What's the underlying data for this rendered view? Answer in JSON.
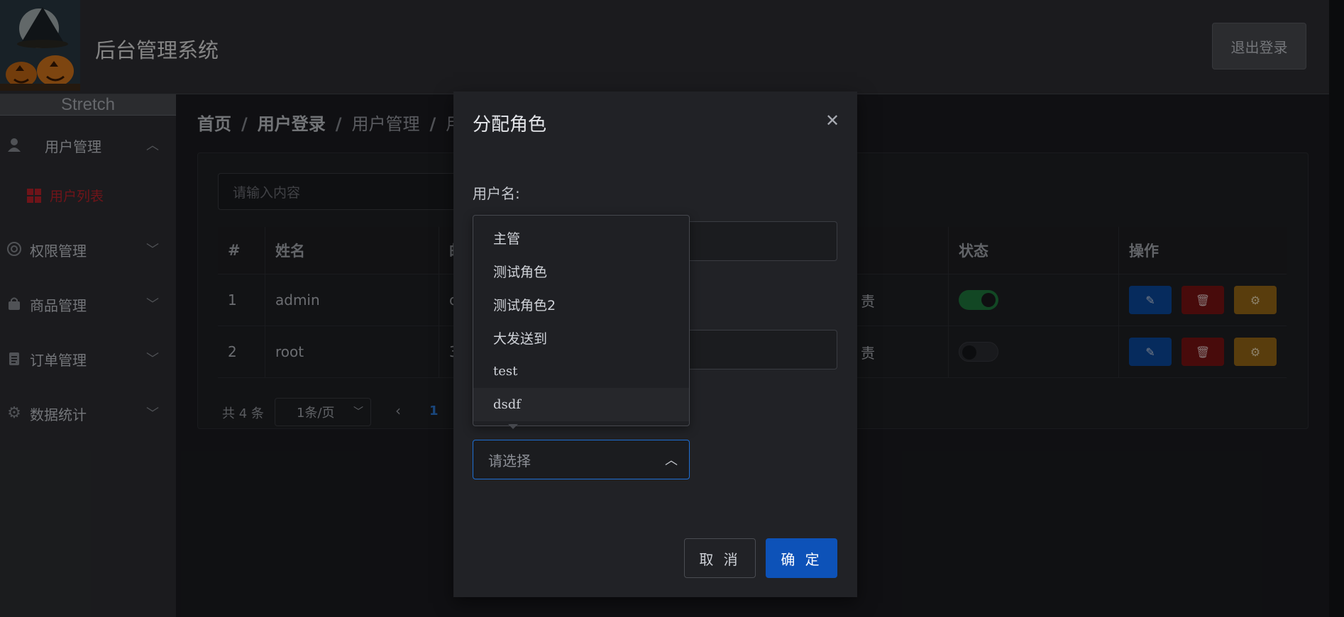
{
  "header": {
    "title": "后台管理系统",
    "logout_label": "退出登录"
  },
  "sidebar": {
    "stretch_label": "Stretch",
    "items": [
      {
        "label": "用户管理",
        "icon": "user-icon",
        "expanded": true,
        "children": [
          {
            "label": "用户列表",
            "icon": "grid-icon",
            "active": true
          }
        ]
      },
      {
        "label": "权限管理",
        "icon": "lifebuoy-icon",
        "expanded": false
      },
      {
        "label": "商品管理",
        "icon": "bag-icon",
        "expanded": false
      },
      {
        "label": "订单管理",
        "icon": "clipboard-icon",
        "expanded": false
      },
      {
        "label": "数据统计",
        "icon": "gear-icon",
        "expanded": false
      }
    ]
  },
  "breadcrumb": {
    "items": [
      "首页",
      "用户登录",
      "用户管理",
      "用"
    ]
  },
  "search": {
    "placeholder": "请输入内容"
  },
  "table": {
    "headers": [
      "#",
      "姓名",
      "‌邮",
      "",
      "状态",
      "操作"
    ],
    "rows": [
      {
        "index": "1",
        "name": "admin",
        "email_partial": "c",
        "role_partial": "责",
        "status_on": true
      },
      {
        "index": "2",
        "name": "root",
        "email_partial": "3",
        "role_partial": "责",
        "status_on": false
      }
    ]
  },
  "pagination": {
    "total": "共 4 条",
    "page_size": "1条/页",
    "current_page": "1"
  },
  "dialog": {
    "title": "分配角色",
    "username_label": "用户名:",
    "select_placeholder": "请选择",
    "cancel_label": "取 消",
    "confirm_label": "确 定"
  },
  "role_options": [
    "主管",
    "测试角色",
    "测试角色2",
    "大发送到",
    "test",
    "dsdf"
  ],
  "colors": {
    "primary": "#0d52b8",
    "danger": "#7d1414",
    "warning": "#9a6a18",
    "active_menu": "#c0242b",
    "success": "#1f7a3f"
  }
}
